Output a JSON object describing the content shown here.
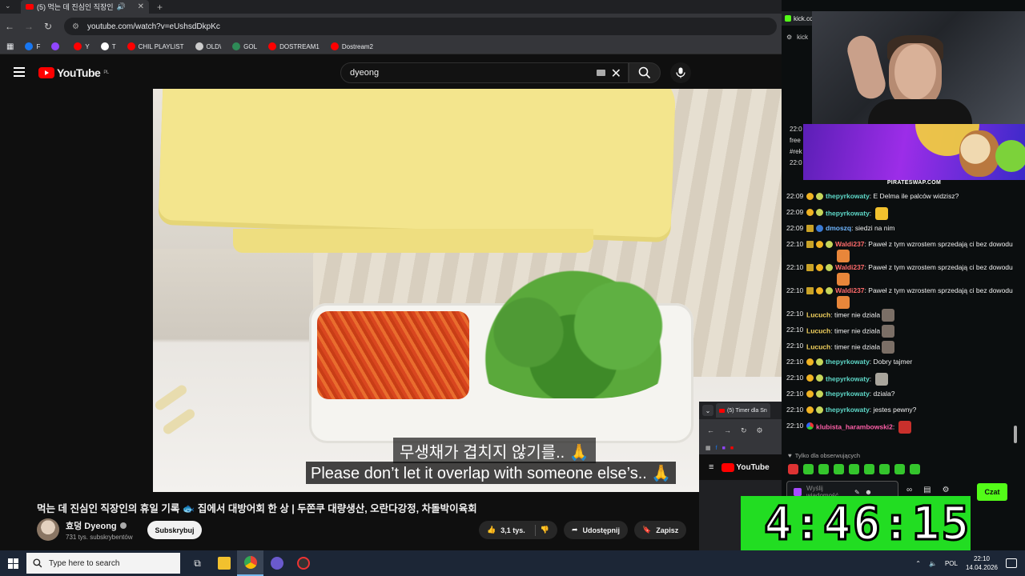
{
  "browser": {
    "tab_title": "(5) 먹는 데 진심인 직장인",
    "url": "youtube.com/watch?v=eUshsdDkpKc",
    "bookmarks": [
      {
        "label": "F",
        "icon": "facebook-icon",
        "color": "#1877f2"
      },
      {
        "label": "",
        "icon": "twitch-icon",
        "color": "#9146ff"
      },
      {
        "label": "Y",
        "icon": "youtube-icon",
        "color": "#ff0000"
      },
      {
        "label": "T",
        "icon": "x-icon",
        "color": "#ffffff"
      },
      {
        "label": "CHIL PLAYLIST",
        "icon": "youtube-icon",
        "color": "#ff0000"
      },
      {
        "label": "OLD\\",
        "icon": "folder-icon",
        "color": "#cccccc"
      },
      {
        "label": "GOL",
        "icon": "gol-icon",
        "color": "#2e8b57"
      },
      {
        "label": "DOSTREAM1",
        "icon": "youtube-icon",
        "color": "#ff0000"
      },
      {
        "label": "Dostream2",
        "icon": "youtube-icon",
        "color": "#ff0000"
      }
    ]
  },
  "youtube": {
    "logo": "YouTube",
    "region": "PL",
    "search_value": "dyeong",
    "video_title": "먹는 데 진심인 직장인의 휴일 기록 🐟 집에서 대방어회 한 상 | 두쫀쿠 대량생산, 오란다강정, 차돌박이육회",
    "subtitle_korean": "무생채가 겹치지 않기를.. 🙏",
    "subtitle_english": "Please don’t let it overlap with someone else’s.. 🙏",
    "channel_name": "효덩 Dyeong",
    "subscribers": "731 tys. subskrybentów",
    "subscribe_label": "Subskrybuj",
    "likes": "3,1 tys.",
    "share_label": "Udostępnij",
    "save_label": "Zapisz"
  },
  "stream": {
    "site_tab": "kick.co",
    "site_addr": "kick",
    "banner_caption": "PIRATESWAP.COM",
    "left_times": [
      "22:0",
      "free",
      "#rek",
      "22:0"
    ],
    "chat": [
      {
        "time": "22:09",
        "badges": [
          "b-gold",
          "b-lime"
        ],
        "user": "thepyrkowaty",
        "color": "#5ed8c8",
        "text": "E Delma ile palców widzisz?",
        "emote": ""
      },
      {
        "time": "22:09",
        "badges": [
          "b-gold",
          "b-lime"
        ],
        "user": "thepyrkowaty",
        "color": "#5ed8c8",
        "text": "",
        "emote": "#f2c12e"
      },
      {
        "time": "22:09",
        "badges": [
          "b-crown",
          "b-blue"
        ],
        "user": "dmoszq",
        "color": "#6fb6ff",
        "text": "siedzi na nim",
        "emote": ""
      },
      {
        "time": "22:10",
        "badges": [
          "b-crown",
          "b-gold",
          "b-lime"
        ],
        "user": "Waldi237",
        "color": "#ff6b6b",
        "text": "Paweł z tym wzrostem sprzedają ci bez dowodu",
        "emote": "#e8863a"
      },
      {
        "time": "22:10",
        "badges": [
          "b-crown",
          "b-gold",
          "b-lime"
        ],
        "user": "Waldi237",
        "color": "#ff6b6b",
        "text": "Paweł z tym wzrostem sprzedają ci bez dowodu",
        "emote": "#e8863a"
      },
      {
        "time": "22:10",
        "badges": [
          "b-crown",
          "b-gold",
          "b-lime"
        ],
        "user": "Waldi237",
        "color": "#ff6b6b",
        "text": "Paweł z tym wzrostem sprzedają ci bez dowodu",
        "emote": "#e8863a"
      },
      {
        "time": "22:10",
        "badges": [],
        "user": "Lucuch",
        "color": "#f2d15e",
        "text": "timer nie dziala",
        "emote": "#7b6f66"
      },
      {
        "time": "22:10",
        "badges": [],
        "user": "Lucuch",
        "color": "#f2d15e",
        "text": "timer nie dziala",
        "emote": "#7b6f66"
      },
      {
        "time": "22:10",
        "badges": [],
        "user": "Lucuch",
        "color": "#f2d15e",
        "text": "timer nie dziala",
        "emote": "#7b6f66"
      },
      {
        "time": "22:10",
        "badges": [
          "b-gold",
          "b-lime"
        ],
        "user": "thepyrkowaty",
        "color": "#5ed8c8",
        "text": "Dobry tajmer",
        "emote": ""
      },
      {
        "time": "22:10",
        "badges": [
          "b-gold",
          "b-lime"
        ],
        "user": "thepyrkowaty",
        "color": "#5ed8c8",
        "text": "",
        "emote": "#a9a59c"
      },
      {
        "time": "22:10",
        "badges": [
          "b-gold",
          "b-lime"
        ],
        "user": "thepyrkowaty",
        "color": "#5ed8c8",
        "text": "dziala?",
        "emote": ""
      },
      {
        "time": "22:10",
        "badges": [
          "b-gold",
          "b-lime"
        ],
        "user": "thepyrkowaty",
        "color": "#5ed8c8",
        "text": "jestes pewny?",
        "emote": ""
      },
      {
        "time": "22:10",
        "badges": [
          "b-multi"
        ],
        "user": "klubista_harambowski2",
        "color": "#ff5fa8",
        "text": "",
        "emote": "#c9302c"
      }
    ],
    "followers_only": "Tylko dla obserwujących",
    "input_placeholder": "Wyślij wiadomość",
    "send_label": "Czat"
  },
  "mini_window": {
    "tab_title": "(5) Timer dla Sn",
    "logo": "YouTube",
    "timer_text": "4:46:15"
  },
  "taskbar": {
    "search_placeholder": "Type here to search",
    "language": "POL",
    "time": "22:10",
    "date": "14.04.2026"
  }
}
